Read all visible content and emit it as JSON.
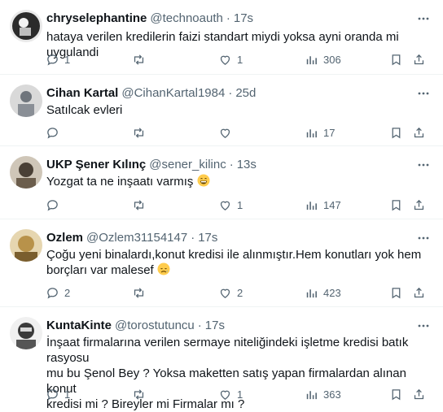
{
  "tweets": [
    {
      "name": "chryselephantine",
      "handle": "@technoauth",
      "time": "17s",
      "text": [
        "hataya verilen kredilerin faizi standart miydi yoksa ayni oranda mi uygulandi"
      ],
      "replies": "1",
      "retweets": "",
      "likes": "1",
      "views": "306",
      "avatar_color": "#2b2b2b"
    },
    {
      "name": "Cihan Kartal",
      "handle": "@CihanKartal1984",
      "time": "25d",
      "text": [
        "Satılcak evleri"
      ],
      "replies": "",
      "retweets": "",
      "likes": "",
      "views": "17",
      "avatar_color": "#8a8f96"
    },
    {
      "name": "UKP Şener Kılınç",
      "handle": "@sener_kilinc",
      "time": "13s",
      "text": [
        "Yozgat ta ne inşaatı varmış"
      ],
      "replies": "",
      "retweets": "",
      "likes": "1",
      "views": "147",
      "avatar_color": "#4a4036"
    },
    {
      "name": "Ozlem",
      "handle": "@Ozlem31154147",
      "time": "17s",
      "text": [
        "Çoğu yeni binalardı,konut kredisi ile alınmıştır.Hem konutları yok hem",
        "borçları var malesef"
      ],
      "replies": "2",
      "retweets": "",
      "likes": "2",
      "views": "423",
      "avatar_color": "#b8924a"
    },
    {
      "name": "KuntaKinte",
      "handle": "@torostutuncu",
      "time": "17s",
      "text": [
        "İnşaat firmalarına verilen sermaye niteliğindeki işletme kredisi batık rasyosu",
        "mu bu Şenol Bey ? Yoksa maketten satış yapan firmalardan alınan konut",
        "kredisi mi ? Bireyler mi Firmalar mı ?"
      ],
      "replies": "1",
      "retweets": "",
      "likes": "1",
      "views": "363",
      "avatar_color": "#d8d8d8"
    }
  ],
  "icons": {
    "reply": "reply-icon",
    "retweet": "retweet-icon",
    "like": "heart-icon",
    "views": "views-icon",
    "bookmark": "bookmark-icon",
    "share": "share-icon",
    "more": "more-icon"
  },
  "colors": {
    "text": "#0f1419",
    "muted": "#536471",
    "divider": "#eff3f4"
  }
}
